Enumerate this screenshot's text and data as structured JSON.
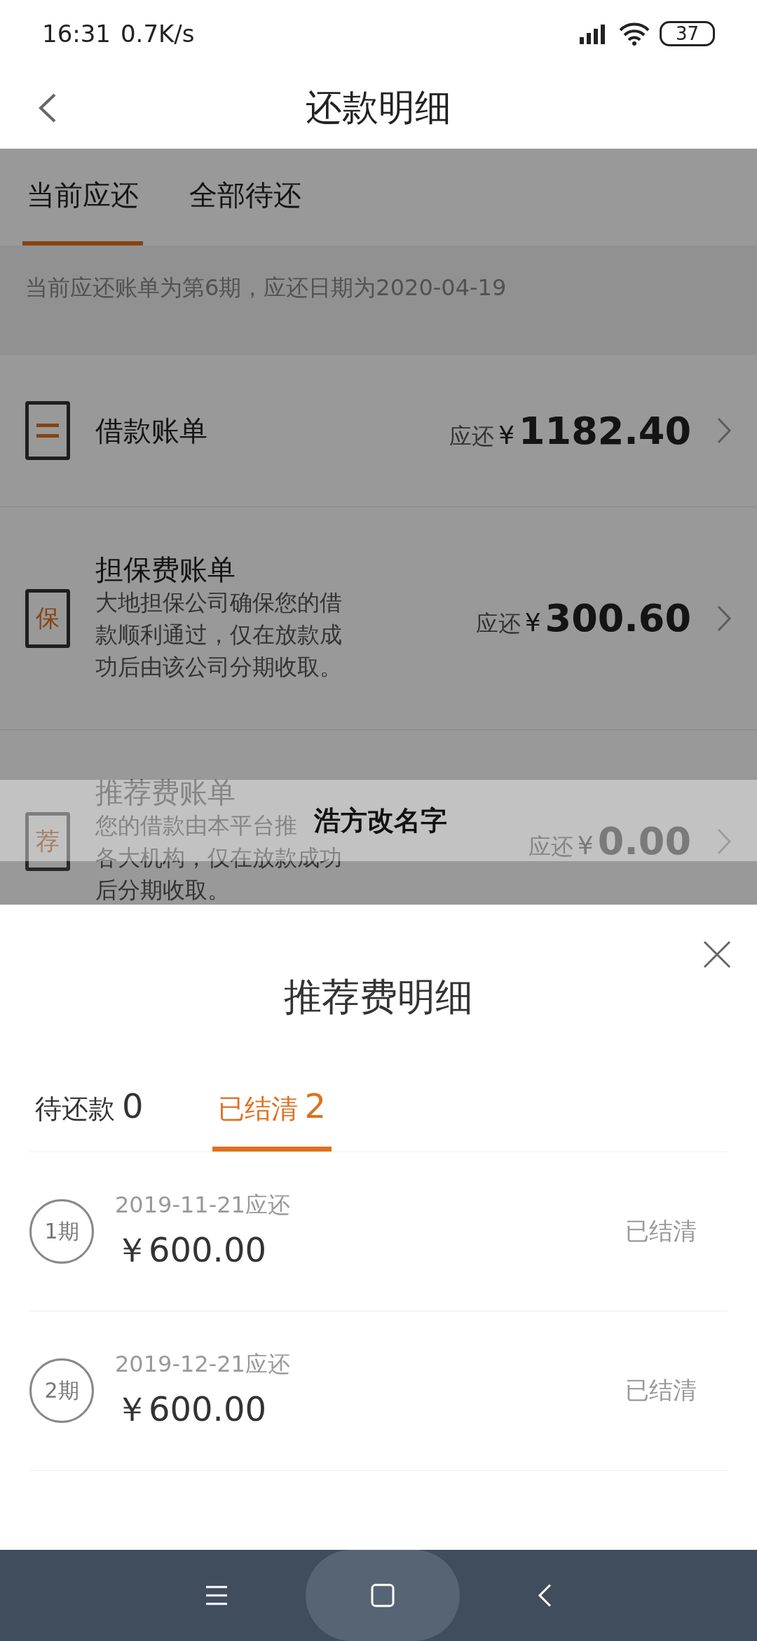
{
  "status_bar": {
    "time": "16:31",
    "speed": "0.7K/s",
    "battery": "37"
  },
  "header": {
    "title": "还款明细"
  },
  "tabs": [
    {
      "label": "当前应还",
      "selected": true
    },
    {
      "label": "全部待还",
      "selected": false
    }
  ],
  "notice": "当前应还账单为第6期，应还日期为2020-04-19",
  "bills": [
    {
      "title": "借款账单",
      "prefix": "应还",
      "currency": "¥",
      "amount": "1182.40",
      "muted": false
    },
    {
      "title": "担保费账单",
      "icon_text": "保",
      "description": [
        "大地担保公司确保您的借",
        "款顺利通过，仅在放款成",
        "功后由该公司分期收取。"
      ],
      "prefix": "应还",
      "currency": "¥",
      "amount": "300.60",
      "muted": false
    },
    {
      "title": "推荐费账单",
      "icon_text": "荐",
      "description": [
        "您的借款由本平台推",
        "各大机构，仅在放款成功",
        "后分期收取。"
      ],
      "prefix": "应还",
      "currency": "¥",
      "amount": "0.00",
      "muted": true
    }
  ],
  "banner": {
    "text": "浩方改名字"
  },
  "sheet": {
    "title": "推荐费明细",
    "tabs": [
      {
        "label": "待还款",
        "count": "0",
        "selected": false
      },
      {
        "label": "已结清",
        "count": "2",
        "selected": true
      }
    ],
    "items": [
      {
        "period": "1期",
        "date": "2019-11-21应还",
        "amount": "￥600.00",
        "status": "已结清"
      },
      {
        "period": "2期",
        "date": "2019-12-21应还",
        "amount": "￥600.00",
        "status": "已结清"
      }
    ]
  }
}
